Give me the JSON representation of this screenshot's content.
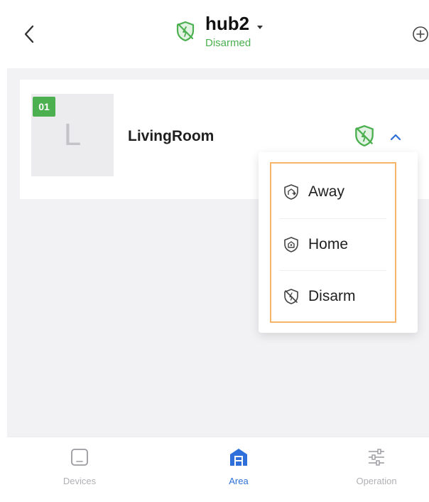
{
  "header": {
    "back_icon": "chevron-left-icon",
    "hub_name": "hub2",
    "hub_status": "Disarmed",
    "status_icon": "shield-disarmed-icon",
    "add_icon": "plus-circle-icon"
  },
  "area": {
    "number": "01",
    "initial": "L",
    "name": "LivingRoom",
    "state_icon": "shield-disarmed-icon",
    "collapse_icon": "chevron-up-icon"
  },
  "mode_menu": {
    "items": [
      {
        "label": "Away",
        "icon": "away-shield-icon"
      },
      {
        "label": "Home",
        "icon": "home-shield-icon"
      },
      {
        "label": "Disarm",
        "icon": "disarm-shield-icon"
      }
    ]
  },
  "tabbar": {
    "tabs": [
      {
        "label": "Devices",
        "icon": "device-square-icon",
        "active": false
      },
      {
        "label": "Area",
        "icon": "area-building-icon",
        "active": true
      },
      {
        "label": "Operation",
        "icon": "sliders-icon",
        "active": false
      }
    ]
  },
  "colors": {
    "accent_green": "#4caf50",
    "accent_blue": "#2e6fd9",
    "highlight_orange": "#f5b56a",
    "inactive_gray": "#b0b0b4"
  }
}
